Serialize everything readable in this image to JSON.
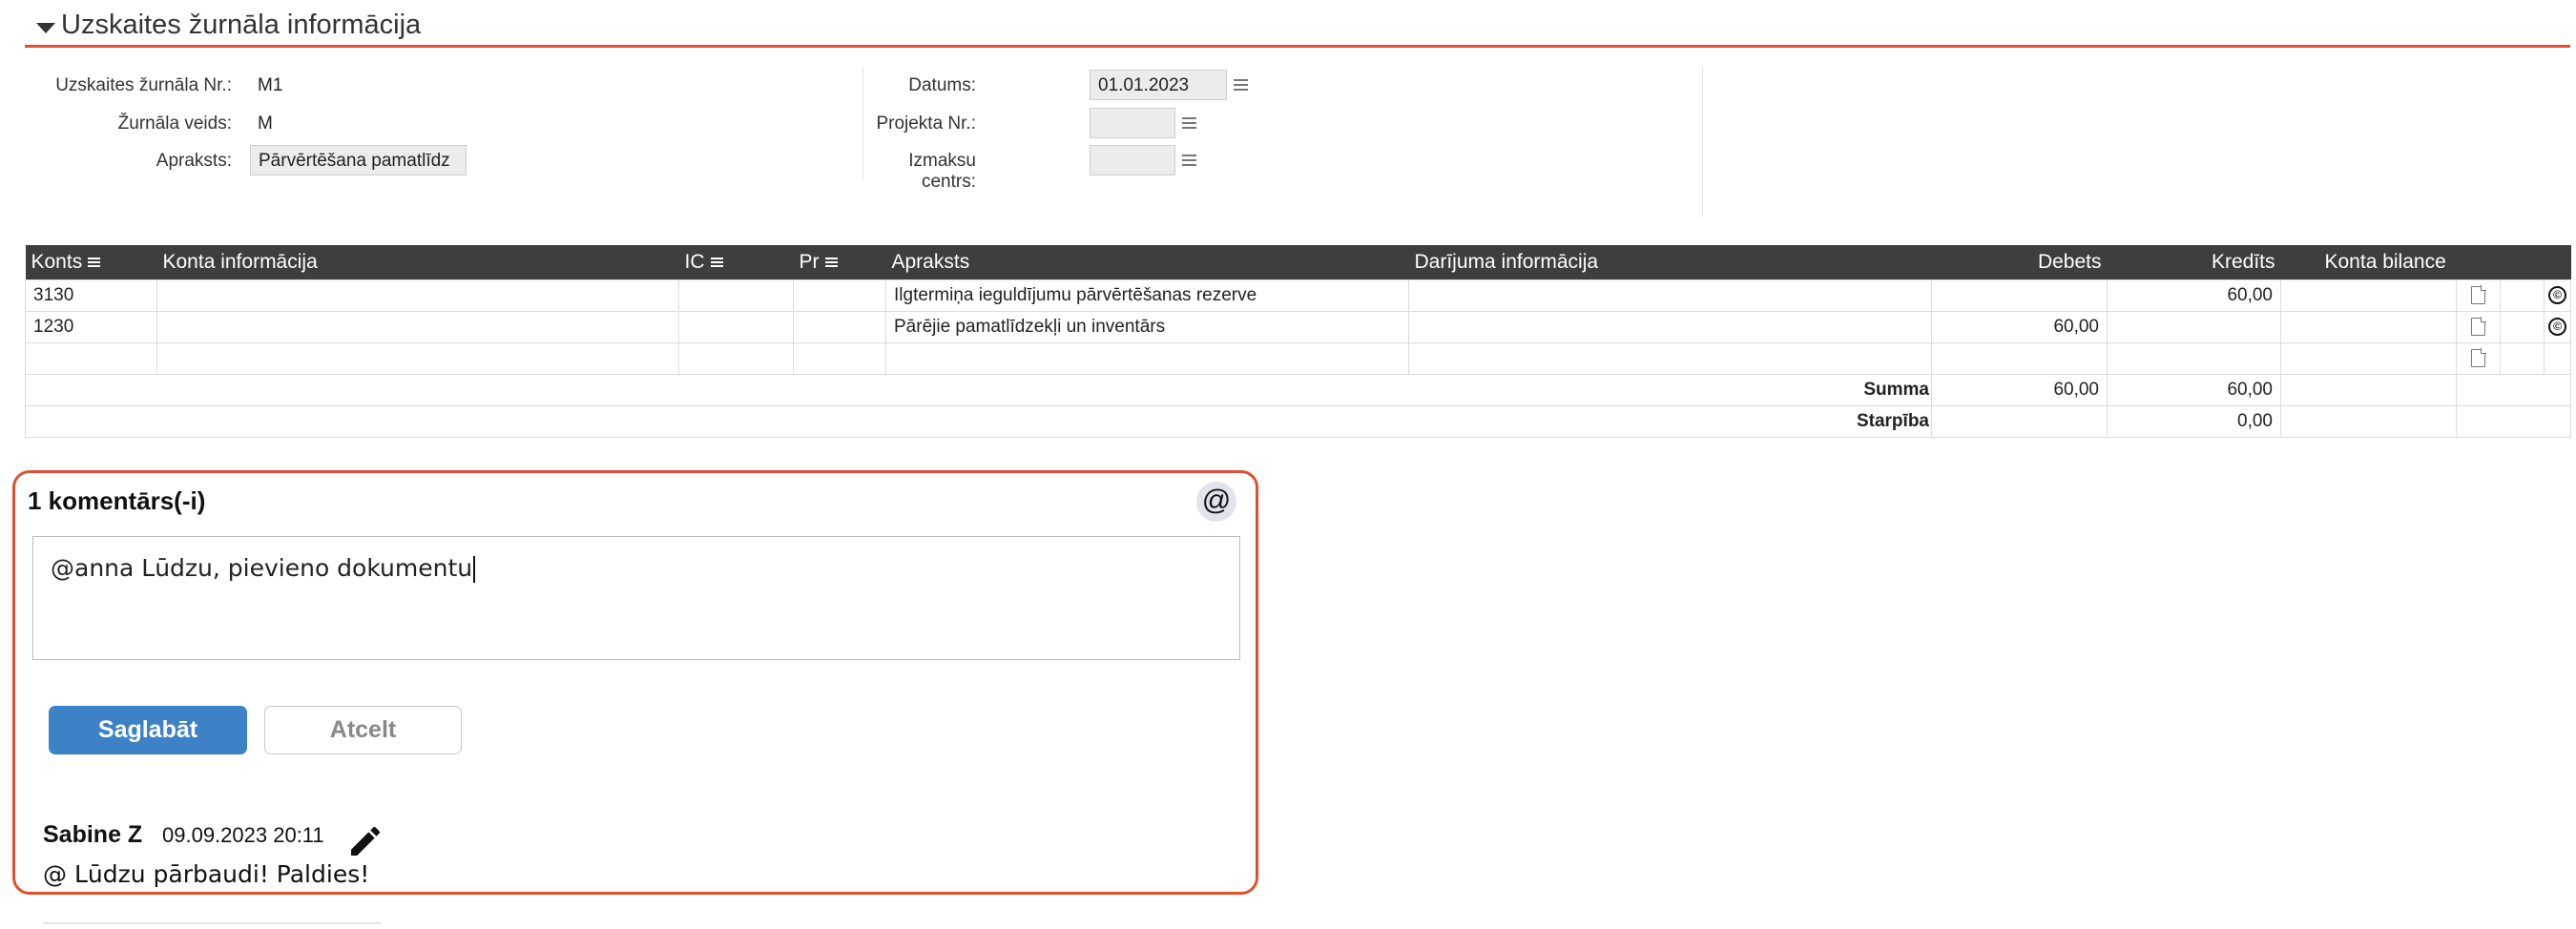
{
  "section": {
    "title": "Uzskaites žurnāla informācija"
  },
  "form": {
    "journal_no_label": "Uzskaites žurnāla Nr.:",
    "journal_no_value": "M1",
    "journal_type_label": "Žurnāla veids:",
    "journal_type_value": "M",
    "description_label": "Apraksts:",
    "description_value": "Pārvērtēšana pamatlīdz",
    "date_label": "Datums:",
    "date_value": "01.01.2023",
    "project_label": "Projekta Nr.:",
    "project_value": "",
    "cost_center_label": "Izmaksu centrs:",
    "cost_center_value": ""
  },
  "table": {
    "columns": {
      "account": "Konts",
      "account_info": "Konta informācija",
      "ic": "IC",
      "pr": "Pr",
      "description": "Apraksts",
      "transaction_info": "Darījuma informācija",
      "debit": "Debets",
      "credit": "Kredīts",
      "balance": "Konta bilance"
    },
    "rows": [
      {
        "account": "3130",
        "account_info": "",
        "ic": "",
        "pr": "",
        "description": "Ilgtermiņa ieguldījumu pārvērtēšanas rezerve",
        "transaction_info": "",
        "debit": "",
        "credit": "60,00",
        "balance": ""
      },
      {
        "account": "1230",
        "account_info": "",
        "ic": "",
        "pr": "",
        "description": "Pārējie pamatlīdzekļi un inventārs",
        "transaction_info": "",
        "debit": "60,00",
        "credit": "",
        "balance": ""
      },
      {
        "account": "",
        "account_info": "",
        "ic": "",
        "pr": "",
        "description": "",
        "transaction_info": "",
        "debit": "",
        "credit": "",
        "balance": ""
      }
    ],
    "sum_label": "Summa",
    "sum_debit": "60,00",
    "sum_credit": "60,00",
    "diff_label": "Starpība",
    "diff_credit": "0,00",
    "copy_symbol": "©"
  },
  "comments": {
    "count_label": "1 komentārs(-i)",
    "mention_symbol": "@",
    "input_value": "@anna Lūdzu, pievieno dokumentu",
    "save_label": "Saglabāt",
    "cancel_label": "Atcelt",
    "items": [
      {
        "author": "Sabine Z",
        "date": "09.09.2023 20:11",
        "text": "@ Lūdzu pārbaudi! Paldies!"
      }
    ]
  },
  "icons": {
    "collapse": "caret-down-icon",
    "list": "list-icon",
    "document": "document-icon",
    "copy": "copyright-icon",
    "edit": "pencil-icon",
    "mention": "at-icon"
  },
  "colors": {
    "accent": "#e0502e",
    "header_bg": "#3e3e3e",
    "primary_button": "#3d82c7"
  }
}
